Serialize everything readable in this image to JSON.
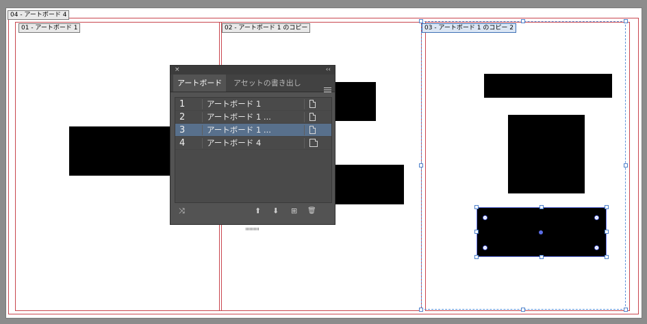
{
  "artboards": {
    "outer_label": "04 - アートボード 4",
    "board1_label": "01 - アートボード 1",
    "board2_label": "02 - アートボード 1 のコピー",
    "board3_label": "03 - アートボード 1 のコピー 2"
  },
  "panel": {
    "close_icon": "×",
    "collapse_icon": "‹‹",
    "tabs": [
      {
        "label": "アートボード"
      },
      {
        "label": "アセットの書き出し"
      }
    ],
    "rows": [
      {
        "num": "1",
        "name": "アートボード 1"
      },
      {
        "num": "2",
        "name": "アートボード 1 ..."
      },
      {
        "num": "3",
        "name": "アートボード 1 ..."
      },
      {
        "num": "4",
        "name": "アートボード 4"
      }
    ],
    "selected_row": 3,
    "toolbar_icons": {
      "rearrange": "⤨",
      "move_up": "⬆",
      "move_down": "⬇",
      "new": "⊞",
      "delete": "🗑"
    }
  },
  "colors": {
    "canvas_bg": "#8c8c8c",
    "artboard_border": "#c8434b",
    "selection": "#5a8fd8",
    "panel_bg": "#535353",
    "selected_row": "#58708c"
  }
}
